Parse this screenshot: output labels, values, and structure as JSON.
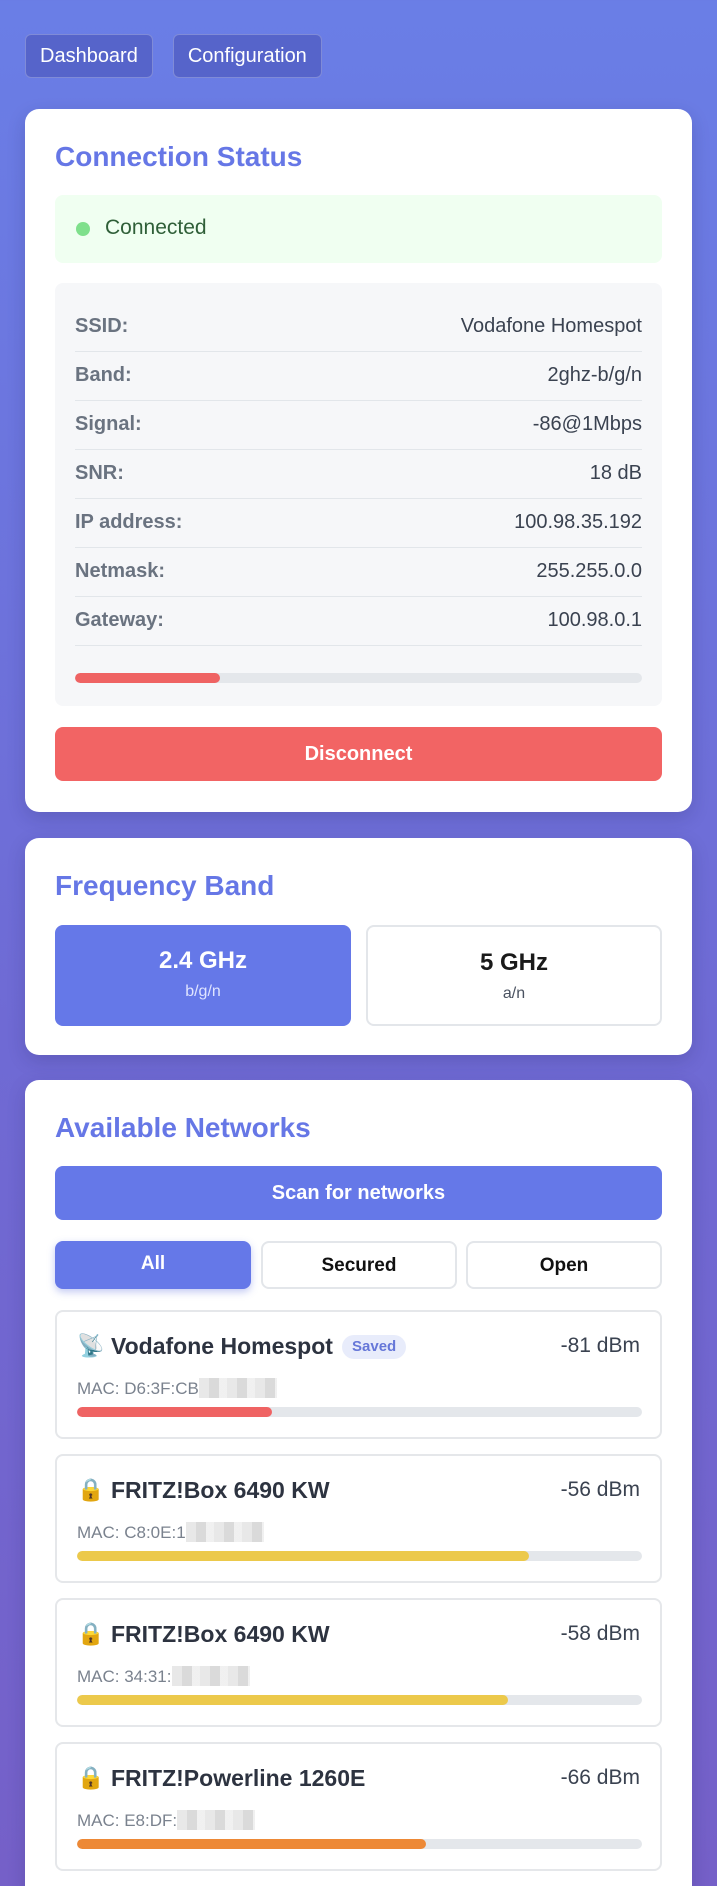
{
  "nav": {
    "dashboard_label": "Dashboard",
    "configuration_label": "Configuration"
  },
  "connection": {
    "title": "Connection Status",
    "status": "Connected",
    "status_color": "#7fe08c",
    "rows": [
      {
        "label": "SSID:",
        "value": "Vodafone Homespot"
      },
      {
        "label": "Band:",
        "value": "2ghz-b/g/n"
      },
      {
        "label": "Signal:",
        "value": "-86@1Mbps"
      },
      {
        "label": "SNR:",
        "value": "18 dB"
      },
      {
        "label": "IP address:",
        "value": "100.98.35.192"
      },
      {
        "label": "Netmask:",
        "value": "255.255.0.0"
      },
      {
        "label": "Gateway:",
        "value": "100.98.0.1"
      }
    ],
    "signal_level": 0.255,
    "signal_color": "#ef6363",
    "disconnect_label": "Disconnect"
  },
  "band": {
    "title": "Frequency Band",
    "options": [
      {
        "name": "2.4 GHz",
        "sub": "b/g/n",
        "active": true
      },
      {
        "name": "5 GHz",
        "sub": "a/n",
        "active": false
      }
    ]
  },
  "networks": {
    "title": "Available Networks",
    "scan_label": "Scan for networks",
    "filters": [
      {
        "label": "All",
        "active": true
      },
      {
        "label": "Secured",
        "active": false
      },
      {
        "label": "Open",
        "active": false
      }
    ],
    "items": [
      {
        "icon": "satellite-antenna-icon",
        "glyph": "📡",
        "name": "Vodafone Homespot",
        "badge": "Saved",
        "dbm": "-81 dBm",
        "mac": "MAC: D6:3F:CB",
        "level": 0.345,
        "color": "#ef6363"
      },
      {
        "icon": "lock-icon",
        "glyph": "🔒",
        "name": "FRITZ!Box 6490 KW",
        "badge": "",
        "dbm": "-56 dBm",
        "mac": "MAC: C8:0E:1",
        "level": 0.8,
        "color": "#ecc94b"
      },
      {
        "icon": "lock-icon",
        "glyph": "🔒",
        "name": "FRITZ!Box 6490 KW",
        "badge": "",
        "dbm": "-58 dBm",
        "mac": "MAC: 34:31:",
        "level": 0.763,
        "color": "#ecc94b"
      },
      {
        "icon": "lock-icon",
        "glyph": "🔒",
        "name": "FRITZ!Powerline 1260E",
        "badge": "",
        "dbm": "-66 dBm",
        "mac": "MAC: E8:DF:",
        "level": 0.618,
        "color": "#ed8936"
      }
    ]
  }
}
